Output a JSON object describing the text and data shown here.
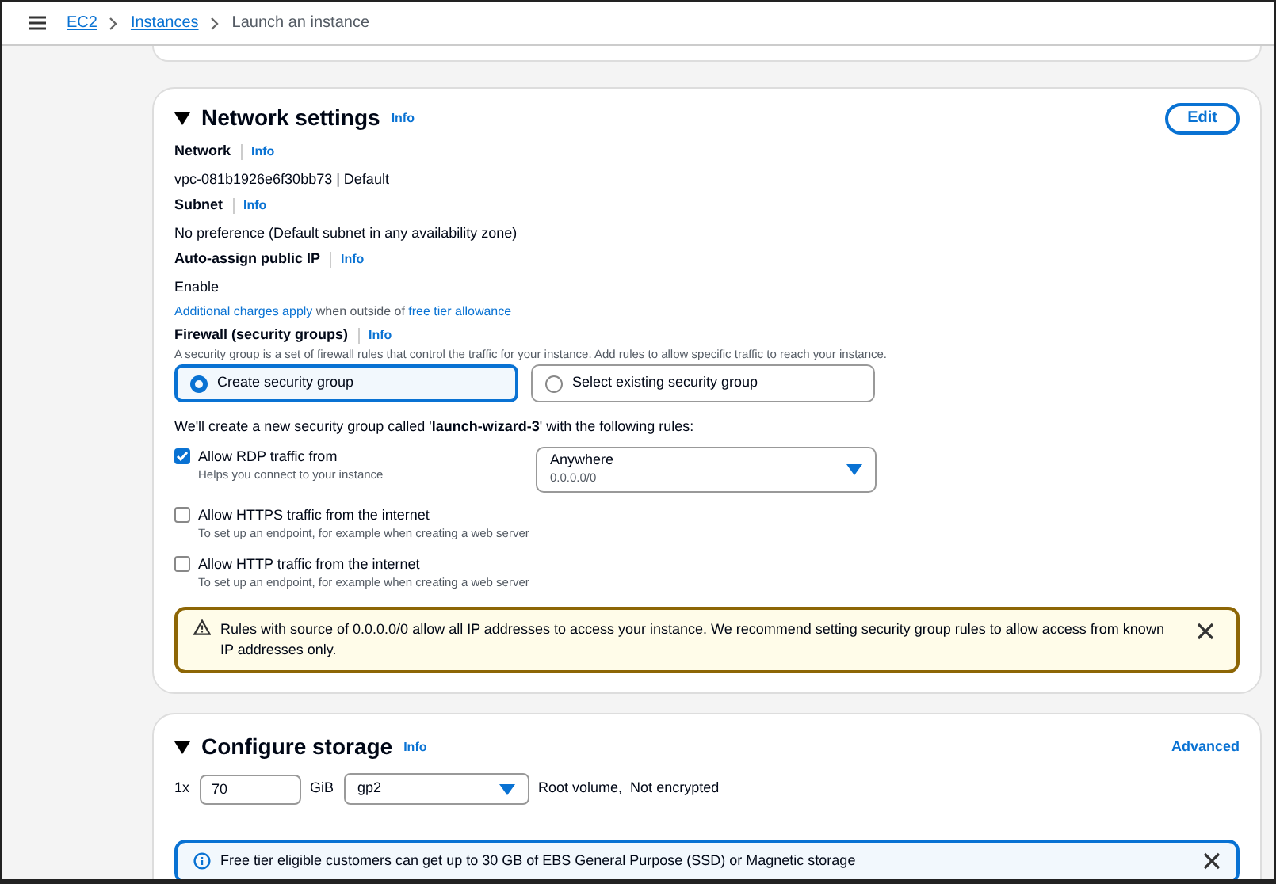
{
  "breadcrumb": [
    {
      "label": "EC2",
      "link": true
    },
    {
      "label": "Instances",
      "link": true
    },
    {
      "label": "Launch an instance",
      "link": false
    }
  ],
  "network": {
    "title": "Network settings",
    "info": "Info",
    "edit": "Edit",
    "fields": [
      {
        "label": "Network",
        "info": "Info",
        "value": "vpc-081b1926e6f30bb73 | Default"
      },
      {
        "label": "Subnet",
        "info": "Info",
        "value": "No preference (Default subnet in any availability zone)"
      },
      {
        "label": "Auto-assign public IP",
        "info": "Info",
        "value": "Enable"
      }
    ],
    "charges": {
      "link1": "Additional charges apply",
      "middle": " when outside of ",
      "link2": "free tier allowance"
    },
    "firewall": {
      "label": "Firewall (security groups)",
      "info": "Info",
      "description": "A security group is a set of firewall rules that control the traffic for your instance. Add rules to allow specific traffic to reach your instance."
    },
    "options": [
      {
        "label": "Create security group",
        "selected": true
      },
      {
        "label": "Select existing security group",
        "selected": false
      }
    ],
    "create_note": "We'll create a new security group called '**launch-wizard-3**' with the following rules:",
    "rules": [
      {
        "label": "Allow RDP traffic from",
        "hint": "Helps you connect to your instance",
        "checked": true,
        "source": {
          "value": "Anywhere",
          "detail": "0.0.0.0/0"
        }
      },
      {
        "label": "Allow HTTPS traffic from the internet",
        "hint": "To set up an endpoint, for example when creating a web server",
        "checked": false
      },
      {
        "label": "Allow HTTP traffic from the internet",
        "hint": "To set up an endpoint, for example when creating a web server",
        "checked": false
      }
    ],
    "warning": "Rules with source of 0.0.0.0/0 allow all IP addresses to access your instance. We recommend setting security group rules to allow access from known IP addresses only."
  },
  "storage": {
    "title": "Configure storage",
    "info": "Info",
    "advanced": "Advanced",
    "count": "1x",
    "size": "70",
    "unit": "GiB",
    "type": "gp2",
    "note": "Root volume,  Not encrypted",
    "alert": "Free tier eligible customers can get up to 30 GB of EBS General Purpose (SSD) or Magnetic storage"
  }
}
